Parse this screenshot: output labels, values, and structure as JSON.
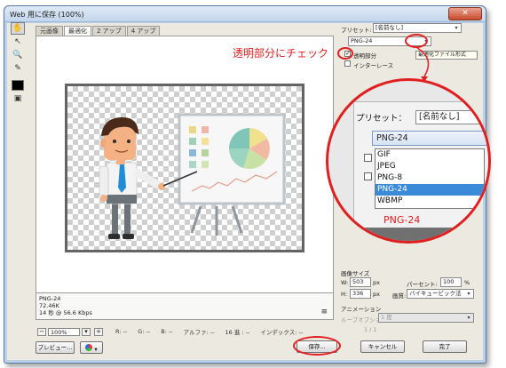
{
  "window": {
    "title": "Web 用に保存 (100%)"
  },
  "tabs": [
    {
      "label": "元画像",
      "active": false
    },
    {
      "label": "最適化",
      "active": true
    },
    {
      "label": "2 アップ",
      "active": false
    },
    {
      "label": "4 アップ",
      "active": false
    }
  ],
  "toolbar": {
    "icons": [
      "hand-icon",
      "slice-select-icon",
      "zoom-icon",
      "eyedropper-icon",
      "color-swatch",
      "preview-toggle-icon"
    ]
  },
  "info": {
    "format": "PNG-24",
    "size": "72.46K",
    "time": "14 秒 @ 56.6 Kbps",
    "menu_glyph": "≡"
  },
  "status": {
    "zoom": "100%",
    "r": "R: --",
    "g": "G: --",
    "b": "B: --",
    "alpha": "アルファ: --",
    "hex": "16 進 : --",
    "index": "インデックス: --"
  },
  "buttons": {
    "preview": "プレビュー...",
    "save": "保存...",
    "cancel": "キャンセル",
    "done": "完了"
  },
  "right": {
    "preset_label": "プリセット:",
    "preset_value": "[名前なし]",
    "format_value": "PNG-24",
    "transparency_label": "透明部分",
    "interlace_label": "インターレース",
    "tooltip": "最適化ファイル形式",
    "image_size_label": "画像サイズ",
    "w_label": "W:",
    "w_value": "503",
    "h_label": "H:",
    "h_value": "336",
    "px": "px",
    "percent_label": "パーセント:",
    "percent_value": "100",
    "percent_unit": "%",
    "quality_label": "画質:",
    "quality_value": "バイキュービック法",
    "animation_label": "アニメーション",
    "loop_label": "ループオプション:",
    "loop_value": "1 度",
    "frame_counter": "1 / 1"
  },
  "zoom_callout": {
    "preset_label": "プリセット：",
    "preset_value": "[名前なし]",
    "selected_format": "PNG-24",
    "options": [
      "GIF",
      "JPEG",
      "PNG-8",
      "PNG-24",
      "WBMP"
    ],
    "selected_index": 3,
    "caption": "PNG-24"
  },
  "annotation": {
    "text": "透明部分にチェック",
    "color": "#e02020"
  }
}
